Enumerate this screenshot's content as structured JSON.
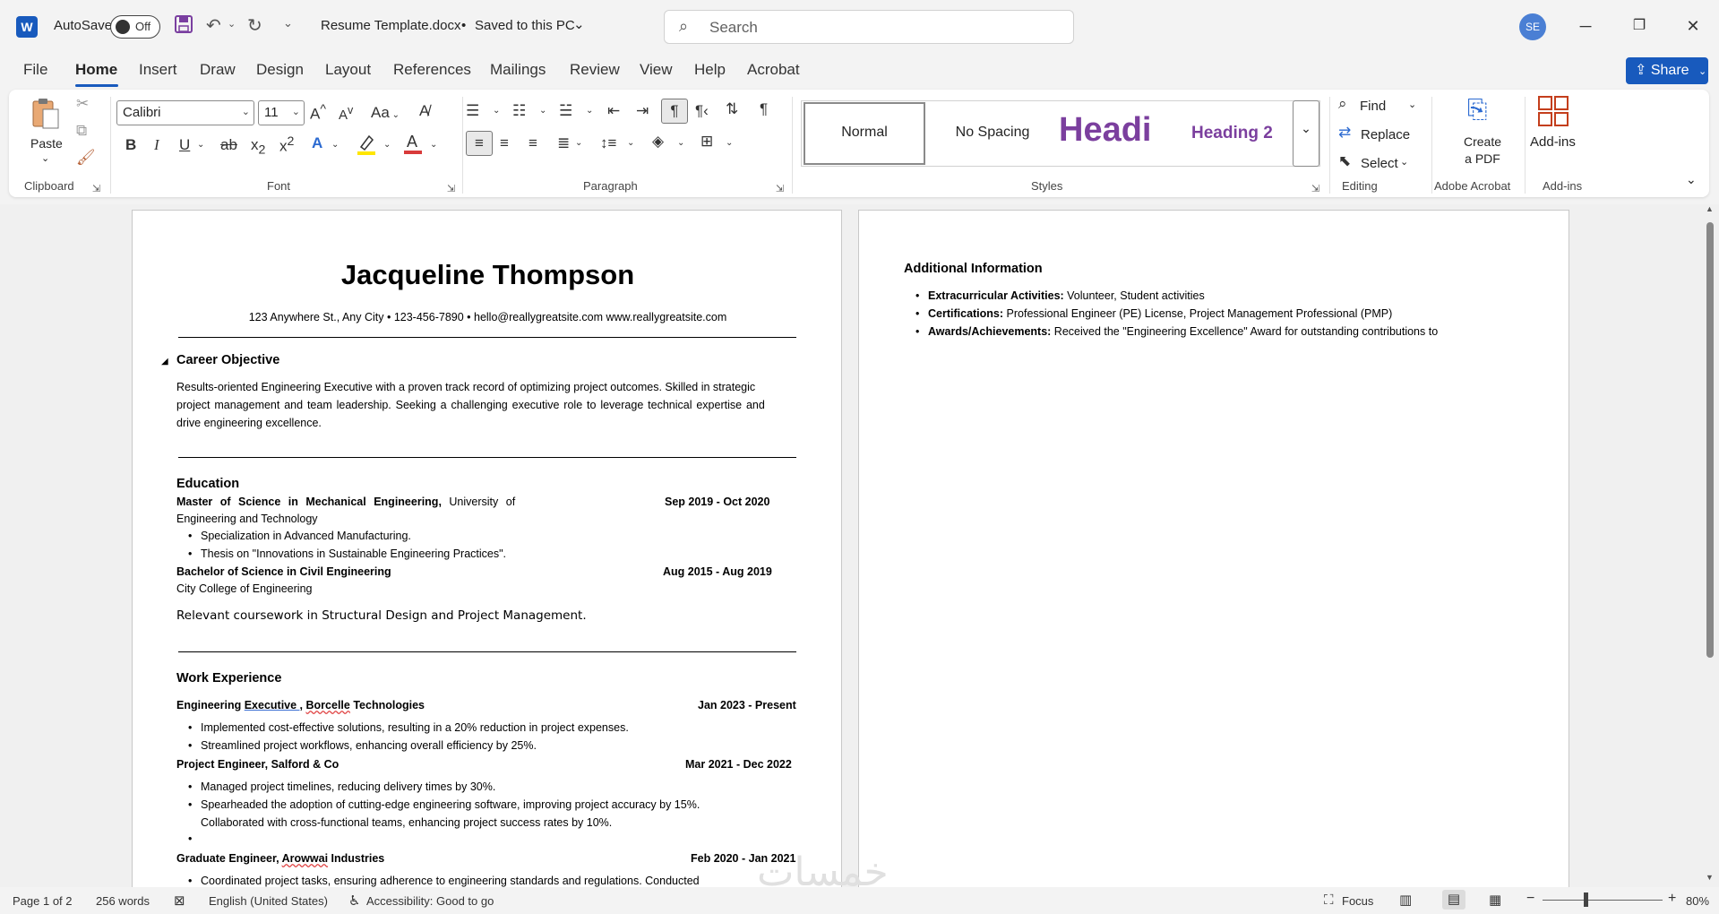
{
  "titlebar": {
    "autosave_label": "AutoSave",
    "autosave_state": "Off",
    "doc_title": "Resume Template.docx",
    "save_status": "Saved to this PC",
    "search_placeholder": "Search",
    "avatar_initials": "SE"
  },
  "tabs": [
    "File",
    "Home",
    "Insert",
    "Draw",
    "Design",
    "Layout",
    "References",
    "Mailings",
    "Review",
    "View",
    "Help",
    "Acrobat"
  ],
  "share_label": "Share",
  "ribbon": {
    "clipboard": {
      "paste": "Paste",
      "label": "Clipboard"
    },
    "font": {
      "name": "Calibri",
      "size": "11",
      "label": "Font",
      "change_case": "Aa"
    },
    "paragraph": {
      "label": "Paragraph"
    },
    "styles": {
      "label": "Styles",
      "items": [
        "Normal",
        "No Spacing",
        "Headi",
        "Heading 2"
      ]
    },
    "editing": {
      "find": "Find",
      "replace": "Replace",
      "select": "Select",
      "label": "Editing"
    },
    "acrobat": {
      "create": "Create",
      "create2": "a PDF",
      "label": "Adobe Acrobat"
    },
    "addins": {
      "button": "Add-ins",
      "label": "Add-ins"
    }
  },
  "page1": {
    "name": "Jacqueline Thompson",
    "contact": "123 Anywhere St., Any City • 123-456-7890 • hello@reallygreatsite.com www.reallygreatsite.com",
    "objective_heading": "Career Objective",
    "objective_lines": [
      "Results-oriented Engineering Executive with a proven track record of optimizing project outcomes. Skilled in strategic",
      "project management and team leadership. Seeking a challenging executive role to leverage technical expertise and",
      "drive engineering excellence."
    ],
    "education_heading": "Education",
    "edu1_bold": "Master of Science in Mechanical Engineering,",
    "edu1_rest": " University of",
    "edu1_line2": "Engineering and Technology",
    "edu1_date": "Sep 2019 - Oct 2020",
    "edu1_bullets": [
      "Specialization in Advanced Manufacturing.",
      "Thesis on \"Innovations in Sustainable Engineering Practices\"."
    ],
    "edu2_bold": "Bachelor of Science in Civil Engineering",
    "edu2_line2": "City College of Engineering",
    "edu2_date": "Aug 2015 - Aug 2019",
    "coursework": "Relevant coursework in Structural Design and Project Management.",
    "work_heading": "Work Experience",
    "job1_a": "Engineering ",
    "job1_b": "Executive ,",
    "job1_c": " ",
    "job1_d": "Borcelle",
    "job1_e": " Technologies",
    "job1_date": "Jan 2023 - Present",
    "job1_bullets": [
      "Implemented cost-effective solutions, resulting in a 20% reduction in project expenses.",
      "Streamlined project workflows, enhancing overall efficiency by 25%."
    ],
    "job2_title": "Project Engineer, Salford & Co",
    "job2_date": "Mar 2021 - Dec 2022",
    "job2_bullets": [
      "Managed project timelines, reducing delivery times by 30%.",
      "Spearheaded the adoption of cutting-edge engineering software, improving project accuracy by 15%."
    ],
    "job2_extra": "Collaborated with cross-functional teams, enhancing project success rates by 10%.",
    "job3_a": "Graduate Engineer, ",
    "job3_b": "Arowwai",
    "job3_c": " Industries",
    "job3_date": "Feb 2020 - Jan 2021",
    "job3_bullet": "Coordinated project tasks, ensuring adherence to engineering standards and regulations. Conducted"
  },
  "page2": {
    "heading": "Additional Information",
    "items": [
      {
        "label": "Extracurricular Activities:",
        "text": " Volunteer, Student activities"
      },
      {
        "label": "Certifications:",
        "text": " Professional Engineer (PE) License, Project Management Professional (PMP)"
      },
      {
        "label": "Awards/Achievements:",
        "text": " Received the \"Engineering Excellence\" Award for outstanding contributions to"
      }
    ]
  },
  "watermark": "خمسات",
  "status": {
    "page": "Page 1 of 2",
    "words": "256 words",
    "language": "English (United States)",
    "accessibility": "Accessibility: Good to go",
    "focus": "Focus",
    "zoom": "80%"
  },
  "colors": {
    "accent": "#185abd",
    "heading_purple": "#7b3f9e"
  }
}
